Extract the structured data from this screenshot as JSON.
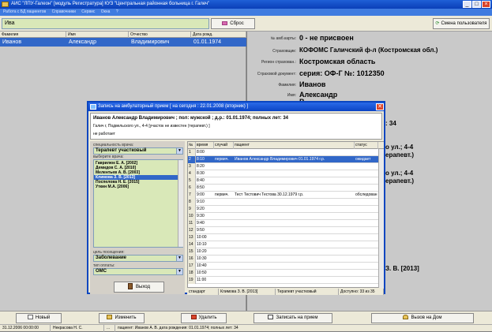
{
  "window": {
    "title": "АИС \"ЛПУ-Галеон\" [модуль Регистратура]    КУЗ \"Центральная районная больница г. Галеч\"",
    "menu": [
      "Работа с БД пациентов",
      "Справочники",
      "Сервис",
      "Окна",
      "?"
    ]
  },
  "toolbar": {
    "search_value": "Ива",
    "reset_label": "Сброс",
    "change_user_label": "Смена пользователя"
  },
  "patients": {
    "columns": [
      "Фамилия",
      "Имя",
      "Отчество",
      "Дата рожд."
    ],
    "rows": [
      {
        "surname": "Иванов",
        "name": "Александр",
        "patronymic": "Владимирович",
        "birth": "01.01.1974"
      }
    ]
  },
  "info": {
    "card_label": "№ амб.карты:",
    "card_value": "0 - не присвоен",
    "insurer_label": "Страховщик:",
    "insurer_value": "КОФОМС Галичский ф-л  (Костромская обл.)",
    "region_label": "Регион страхован.:",
    "region_value": "Костромская область",
    "doc_label": "Страховой документ:",
    "doc_value": "серия: ОФ-Г  №: 1012350",
    "surname_label": "Фамилия:",
    "surname_value": "Иванов",
    "name_label": "Имя:",
    "name_value": "Александр",
    "partial_1": "В",
    "age_fragment": ": 34",
    "addr_fragment_1": "о ул.; 4-4",
    "therapist_fragment_1": "ерапевт.)",
    "addr_fragment_2": "о ул.; 4-4",
    "therapist_fragment_2": "ерапевт.)",
    "doctor_fragment": "З. В.    [2013]"
  },
  "dialog": {
    "title": "Запись на амбулаторный прием    [ на сегодня :  22.01.2008  (вторник) ]",
    "close_label": "✕",
    "patient_line": "Иванов Александр Владимирович ;   пол: мужской ;   д.р.: 01.01.1974;  полных лет: 34",
    "address_line": "Галич г, Подвельского ул., 4-4  [участок не известен (терапевт.) ]",
    "work_line": "не работает",
    "specialty_label": "специальность врача:",
    "specialty_value": "Терапевт участковый",
    "doctor_choose_label": "выберите врача:",
    "doctors": [
      "Гаврилюк Е. А.   [2002]",
      "Демидов С. А.   [2010]",
      "Мелентьев А. В.   [2003]",
      "Климова З. В.   [2013]",
      "Поспелова Н. Е.   [2015]",
      "Уткин М.А.   [2006]"
    ],
    "selected_doctor_index": 3,
    "visit_purpose_label": "цель посещения:",
    "visit_purpose_value": "Заболевание",
    "payment_label": "тип оплаты:",
    "payment_value": "ОМС",
    "exit_label": "Выход",
    "schedule_columns": [
      "№",
      "время",
      "случай",
      "пациент",
      "статус"
    ],
    "schedule": [
      {
        "n": "1",
        "time": "8:00",
        "case": "",
        "patient": "",
        "status": ""
      },
      {
        "n": "2",
        "time": "8:10",
        "case": "первич.",
        "patient": "Иванов Александр Владимирович 01.01.1974 г.р.",
        "status": "ожидает"
      },
      {
        "n": "3",
        "time": "8:20",
        "case": "",
        "patient": "",
        "status": ""
      },
      {
        "n": "4",
        "time": "8:30",
        "case": "",
        "patient": "",
        "status": ""
      },
      {
        "n": "5",
        "time": "8:40",
        "case": "",
        "patient": "",
        "status": ""
      },
      {
        "n": "6",
        "time": "8:50",
        "case": "",
        "patient": "",
        "status": ""
      },
      {
        "n": "7",
        "time": "9:00",
        "case": "первич.",
        "patient": "Тест Тестович Тестова 30.12.1979 г.р.",
        "status": "обследован"
      },
      {
        "n": "8",
        "time": "9:10",
        "case": "",
        "patient": "",
        "status": ""
      },
      {
        "n": "9",
        "time": "9:20",
        "case": "",
        "patient": "",
        "status": ""
      },
      {
        "n": "10",
        "time": "9:30",
        "case": "",
        "patient": "",
        "status": ""
      },
      {
        "n": "11",
        "time": "9:40",
        "case": "",
        "patient": "",
        "status": ""
      },
      {
        "n": "12",
        "time": "9:50",
        "case": "",
        "patient": "",
        "status": ""
      },
      {
        "n": "13",
        "time": "10:00",
        "case": "",
        "patient": "",
        "status": ""
      },
      {
        "n": "14",
        "time": "10:10",
        "case": "",
        "patient": "",
        "status": ""
      },
      {
        "n": "15",
        "time": "10:20",
        "case": "",
        "patient": "",
        "status": ""
      },
      {
        "n": "16",
        "time": "10:30",
        "case": "",
        "patient": "",
        "status": ""
      },
      {
        "n": "17",
        "time": "10:40",
        "case": "",
        "patient": "",
        "status": ""
      },
      {
        "n": "18",
        "time": "10:50",
        "case": "",
        "patient": "",
        "status": ""
      },
      {
        "n": "19",
        "time": "11:00",
        "case": "",
        "patient": "",
        "status": ""
      }
    ],
    "selected_schedule_index": 1,
    "status_cells": [
      "стандарт",
      "Климова З. В.   [2013]",
      "Терапевт участковый",
      "Доступно: 33 из 35"
    ]
  },
  "bottom_buttons": {
    "new_label": "Новый",
    "edit_label": "Изменить",
    "delete_label": "Удалить",
    "record_label": "Записать на прием",
    "home_call_label": "Вызов на Дом"
  },
  "statusbar": {
    "datetime": "31.12.2006 00:00:00",
    "user": "Некрасова Н. С.",
    "dots": "...",
    "patient_info": "пациент: Иванов А. В.  дата рождения: 01.01.1974;  полных лет: 34"
  },
  "colors": {
    "title_blue": "#0a3fb8",
    "selection_blue": "#3167c8",
    "input_green": "#d9e8b8",
    "panel_gray": "#c9c9c9"
  }
}
